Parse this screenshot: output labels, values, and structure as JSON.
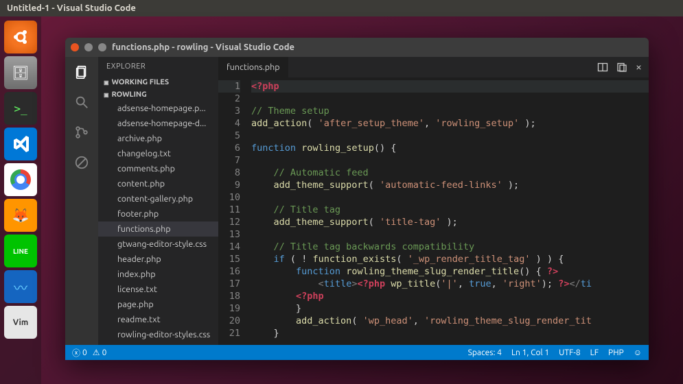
{
  "desktop": {
    "menubar_title": "Untitled-1 - Visual Studio Code",
    "launcher": [
      {
        "name": "ubuntu",
        "glyph": ""
      },
      {
        "name": "files",
        "glyph": "🗄"
      },
      {
        "name": "terminal",
        "glyph": ">_"
      },
      {
        "name": "vscode",
        "glyph": ""
      },
      {
        "name": "chrome",
        "glyph": ""
      },
      {
        "name": "firefox",
        "glyph": "🦊"
      },
      {
        "name": "line",
        "glyph": "LINE"
      },
      {
        "name": "sysmon",
        "glyph": "〰"
      },
      {
        "name": "vim",
        "glyph": "Vim"
      }
    ]
  },
  "vscode": {
    "title": "functions.php - rowling - Visual Studio Code",
    "activitybar": [
      "explorer",
      "search",
      "git",
      "debug"
    ],
    "sidebar": {
      "header": "EXPLORER",
      "sections": {
        "working_files": "WORKING FILES",
        "folder": "ROWLING"
      },
      "files": [
        "adsense-homepage.p...",
        "adsense-homepage-d...",
        "archive.php",
        "changelog.txt",
        "comments.php",
        "content.php",
        "content-gallery.php",
        "footer.php",
        "functions.php",
        "gtwang-editor-style.css",
        "header.php",
        "index.php",
        "license.txt",
        "page.php",
        "readme.txt",
        "rowling-editor-styles.css"
      ],
      "selected": "functions.php"
    },
    "editor": {
      "tab": "functions.php",
      "line_start": 1,
      "line_end": 21
    },
    "statusbar": {
      "errors": "0",
      "warnings": "0",
      "spaces": "Spaces: 4",
      "cursor": "Ln 1, Col 1",
      "encoding": "UTF-8",
      "eol": "LF",
      "lang": "PHP",
      "smiley": "☺"
    }
  }
}
